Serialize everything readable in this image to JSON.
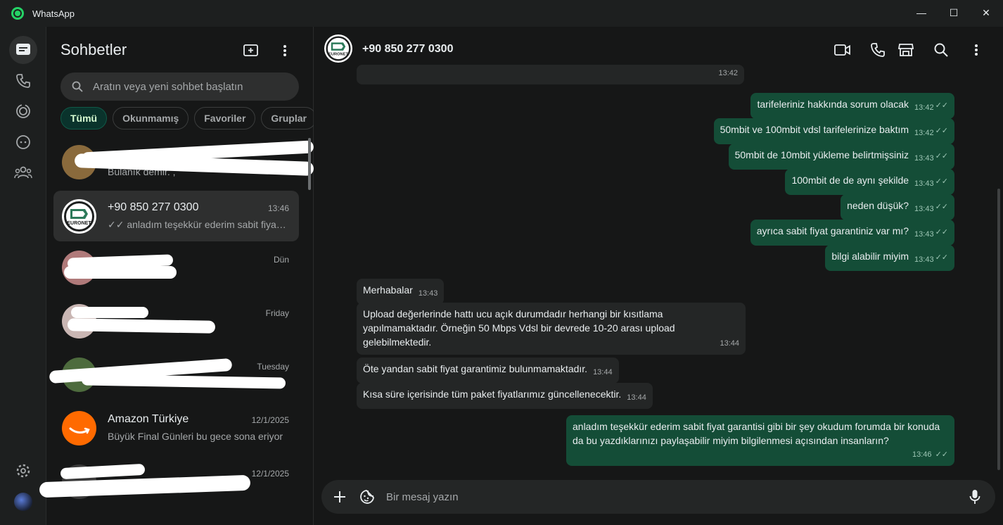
{
  "window": {
    "app_title": "WhatsApp",
    "minimize": "—",
    "maximize": "☐",
    "close": "✕"
  },
  "sidebar": {
    "title": "Sohbetler",
    "search_placeholder": "Aratın veya yeni sohbet başlatın",
    "filters": [
      "Tümü",
      "Okunmamış",
      "Favoriler",
      "Gruplar"
    ],
    "chats": [
      {
        "name": "",
        "time": "",
        "preview": "Bulanık demir. ;"
      },
      {
        "name": "+90 850 277 0300",
        "time": "13:46",
        "preview": "✓✓ anladım teşekkür ederim sabit fiyat garantisi gibi bir şey okudum",
        "avatar_label": "EURONET"
      },
      {
        "name": "",
        "time": "Dün",
        "preview": ""
      },
      {
        "name": "",
        "time": "Friday",
        "preview": ""
      },
      {
        "name": "",
        "time": "Tuesday",
        "preview": ""
      },
      {
        "name": "Amazon Türkiye",
        "time": "12/1/2025",
        "preview": "Büyük Final Günleri bu gece sona eriyor"
      },
      {
        "name": "",
        "time": "12/1/2025",
        "preview": ""
      }
    ]
  },
  "conversation": {
    "contact_name": "+90 850 277 0300",
    "avatar_label": "EURONET",
    "composer_placeholder": "Bir mesaj yazın",
    "messages": [
      {
        "dir": "in",
        "text": "",
        "time": "13:42"
      },
      {
        "dir": "out",
        "text": "tarifeleriniz hakkında sorum olacak",
        "time": "13:42"
      },
      {
        "dir": "out",
        "text": "50mbit ve 100mbit vdsl tarifelerinize baktım",
        "time": "13:42"
      },
      {
        "dir": "out",
        "text": "50mbit de 10mbit yükleme belirtmişsiniz",
        "time": "13:43"
      },
      {
        "dir": "out",
        "text": "100mbit de de aynı şekilde",
        "time": "13:43"
      },
      {
        "dir": "out",
        "text": "neden düşük?",
        "time": "13:43"
      },
      {
        "dir": "out",
        "text": "ayrıca sabit fiyat garantiniz var mı?",
        "time": "13:43"
      },
      {
        "dir": "out",
        "text": "bilgi alabilir miyim",
        "time": "13:43"
      },
      {
        "dir": "in",
        "text": "Merhabalar",
        "time": "13:43"
      },
      {
        "dir": "in",
        "text": "Upload değerlerinde hattı ucu açık durumdadır herhangi bir kısıtlama yapılmamaktadır. Örneğin 50 Mbps Vdsl bir devrede 10-20 arası upload gelebilmektedir.",
        "time": "13:44"
      },
      {
        "dir": "in",
        "text": "Öte yandan sabit fiyat garantimiz bulunmamaktadır.",
        "time": "13:44"
      },
      {
        "dir": "in",
        "text": "Kısa süre içerisinde tüm paket fiyatlarımız güncellenecektir.",
        "time": "13:44"
      },
      {
        "dir": "out",
        "text": "anladım teşekkür ederim sabit fiyat garantisi gibi bir şey okudum forumda bir konuda da bu yazdıklarınızı paylaşabilir miyim bilgilenmesi açısından insanların?",
        "time": "13:46"
      }
    ]
  },
  "ticks": "✓✓",
  "colors": {
    "accent": "#25d366",
    "outgoing_bubble": "#144d37",
    "incoming_bubble": "#242626",
    "active_filter": "#0a332c",
    "amazon": "#ff6a00"
  }
}
